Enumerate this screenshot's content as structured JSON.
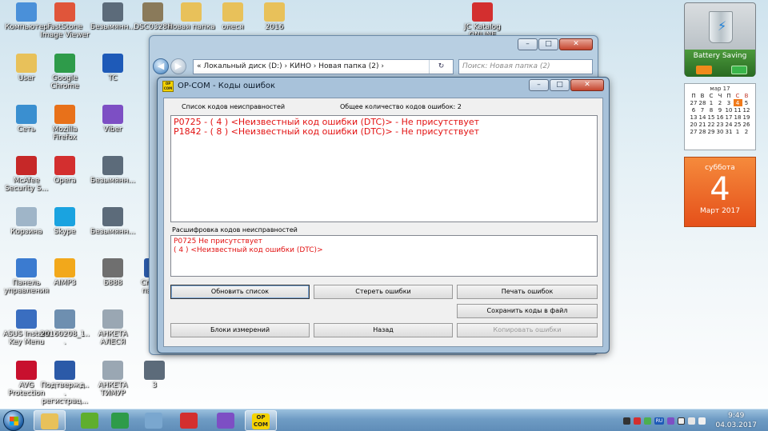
{
  "desktop": {
    "icons": [
      {
        "label": "Компьютер",
        "icon": "computer-icon",
        "color": "#4a90d9"
      },
      {
        "label": "FastStone Image Viewer",
        "icon": "faststone-icon",
        "color": "#e0553a"
      },
      {
        "label": "Безымянн...",
        "icon": "image-icon",
        "color": "#5c6b7a"
      },
      {
        "label": "DSC03284",
        "icon": "photo-icon",
        "color": "#8a7a5a"
      },
      {
        "label": "Новая папка",
        "icon": "folder-icon",
        "color": "#e8c15a"
      },
      {
        "label": "олеся",
        "icon": "folder-icon",
        "color": "#e8c15a"
      },
      {
        "label": "2016",
        "icon": "folder-icon",
        "color": "#e8c15a"
      },
      {
        "label": "JC Katalog ONLINE",
        "icon": "jc-katalog-icon",
        "color": "#d32f2f"
      },
      {
        "label": "User",
        "icon": "user-folder-icon",
        "color": "#e8c15a"
      },
      {
        "label": "Google Chrome",
        "icon": "chrome-icon",
        "color": "#2e9b4a"
      },
      {
        "label": "TC",
        "icon": "total-commander-icon",
        "color": "#1e5ab8"
      },
      {
        "label": "Сеть",
        "icon": "network-icon",
        "color": "#3a8fd0"
      },
      {
        "label": "Mozilla Firefox",
        "icon": "firefox-icon",
        "color": "#e8711a"
      },
      {
        "label": "Viber",
        "icon": "viber-icon",
        "color": "#7d4fc4"
      },
      {
        "label": "McAfee Security S...",
        "icon": "mcafee-icon",
        "color": "#c62828"
      },
      {
        "label": "Opera",
        "icon": "opera-icon",
        "color": "#d32f2f"
      },
      {
        "label": "Безымянн...",
        "icon": "image-icon",
        "color": "#5c6b7a"
      },
      {
        "label": "Корзина",
        "icon": "recycle-bin-icon",
        "color": "#9fb5c8"
      },
      {
        "label": "Skype",
        "icon": "skype-icon",
        "color": "#1aa3e0"
      },
      {
        "label": "Безымянн...",
        "icon": "image-icon",
        "color": "#5c6b7a"
      },
      {
        "label": "Панель управления",
        "icon": "control-panel-icon",
        "color": "#3b7bd0"
      },
      {
        "label": "AIMP3",
        "icon": "aimp-icon",
        "color": "#f2a81b"
      },
      {
        "label": "Б888",
        "icon": "document-icon",
        "color": "#6f6f6f"
      },
      {
        "label": "Список парт...",
        "icon": "word-doc-icon",
        "color": "#2b5aa8"
      },
      {
        "label": "ASUS Instant Key Menu",
        "icon": "asus-icon",
        "color": "#3a6ec0"
      },
      {
        "label": "20160208_1...",
        "icon": "photo-icon",
        "color": "#6e8fb0"
      },
      {
        "label": "АНКЕТА АЛЕСЯ",
        "icon": "form-icon",
        "color": "#9aa7b3"
      },
      {
        "label": "AVG Protection",
        "icon": "avg-icon",
        "color": "#c8102e"
      },
      {
        "label": "Подтвержд... регистрац...",
        "icon": "word-doc-icon",
        "color": "#2b5aa8"
      },
      {
        "label": "АНКЕТА ТИМУР",
        "icon": "form-icon",
        "color": "#9aa7b3"
      },
      {
        "label": "3",
        "icon": "image-icon",
        "color": "#5c6b7a"
      }
    ]
  },
  "explorer": {
    "address": "« Локальный диск (D:) › КИНО › Новая папка (2) ›",
    "search_placeholder": "Поиск: Новая папка (2)"
  },
  "opcom": {
    "title": "OP-COM - Коды ошибок",
    "logo": "OP COM",
    "list_label": "Список кодов неисправностей",
    "count_label": "Общее количество кодов ошибок:",
    "count": "2",
    "codes": [
      "P0725 - ( 4 )  <Неизвестный код ошибки (DTC)> - Не присутствует",
      "P1842 - ( 8 )  <Неизвестный код ошибки (DTC)> - Не присутствует"
    ],
    "decode_label": "Расшифровка кодов неисправностей",
    "decode_lines": [
      "P0725  Не присутствует",
      "( 4 )  <Неизвестный код ошибки (DTC)>"
    ],
    "buttons": {
      "refresh": "Обновить список",
      "clear": "Стереть ошибки",
      "print": "Печать ошибок",
      "save": "Сохранить коды в файл",
      "blocks": "Блоки измерений",
      "back": "Назад",
      "copy": "Копировать ошибки"
    }
  },
  "gadgets": {
    "battery_label": "Battery Saving",
    "calendar": {
      "month": "мар 17",
      "weekdays": [
        "П",
        "В",
        "С",
        "Ч",
        "П",
        "С",
        "В"
      ],
      "rows": [
        [
          "27",
          "28",
          "1",
          "2",
          "3",
          "4",
          "5"
        ],
        [
          "6",
          "7",
          "8",
          "9",
          "10",
          "11",
          "12"
        ],
        [
          "13",
          "14",
          "15",
          "16",
          "17",
          "18",
          "19"
        ],
        [
          "20",
          "21",
          "22",
          "23",
          "24",
          "25",
          "26"
        ],
        [
          "27",
          "28",
          "29",
          "30",
          "31",
          "1",
          "2"
        ]
      ]
    },
    "date_tile": {
      "weekday": "суббота",
      "day": "4",
      "month": "Март 2017"
    }
  },
  "taskbar": {
    "apps": [
      {
        "name": "explorer",
        "icon": "explorer-taskbar-icon",
        "color": "#e8c15a",
        "active": true
      },
      {
        "name": "utorrent",
        "icon": "utorrent-taskbar-icon",
        "color": "#5fae2e"
      },
      {
        "name": "chrome",
        "icon": "chrome-taskbar-icon",
        "color": "#2e9b4a"
      },
      {
        "name": "calculator",
        "icon": "calculator-taskbar-icon",
        "color": "#7aa7cf"
      },
      {
        "name": "opera",
        "icon": "opera-taskbar-icon",
        "color": "#d32f2f"
      },
      {
        "name": "viber",
        "icon": "viber-taskbar-icon",
        "color": "#7d4fc4"
      },
      {
        "name": "opcom",
        "icon": "opcom-taskbar-icon",
        "color": "#f5d300",
        "label": "OP COM",
        "active": true
      }
    ],
    "time": "9:49",
    "date": "04.03.2017",
    "tray_lang": "RU"
  }
}
